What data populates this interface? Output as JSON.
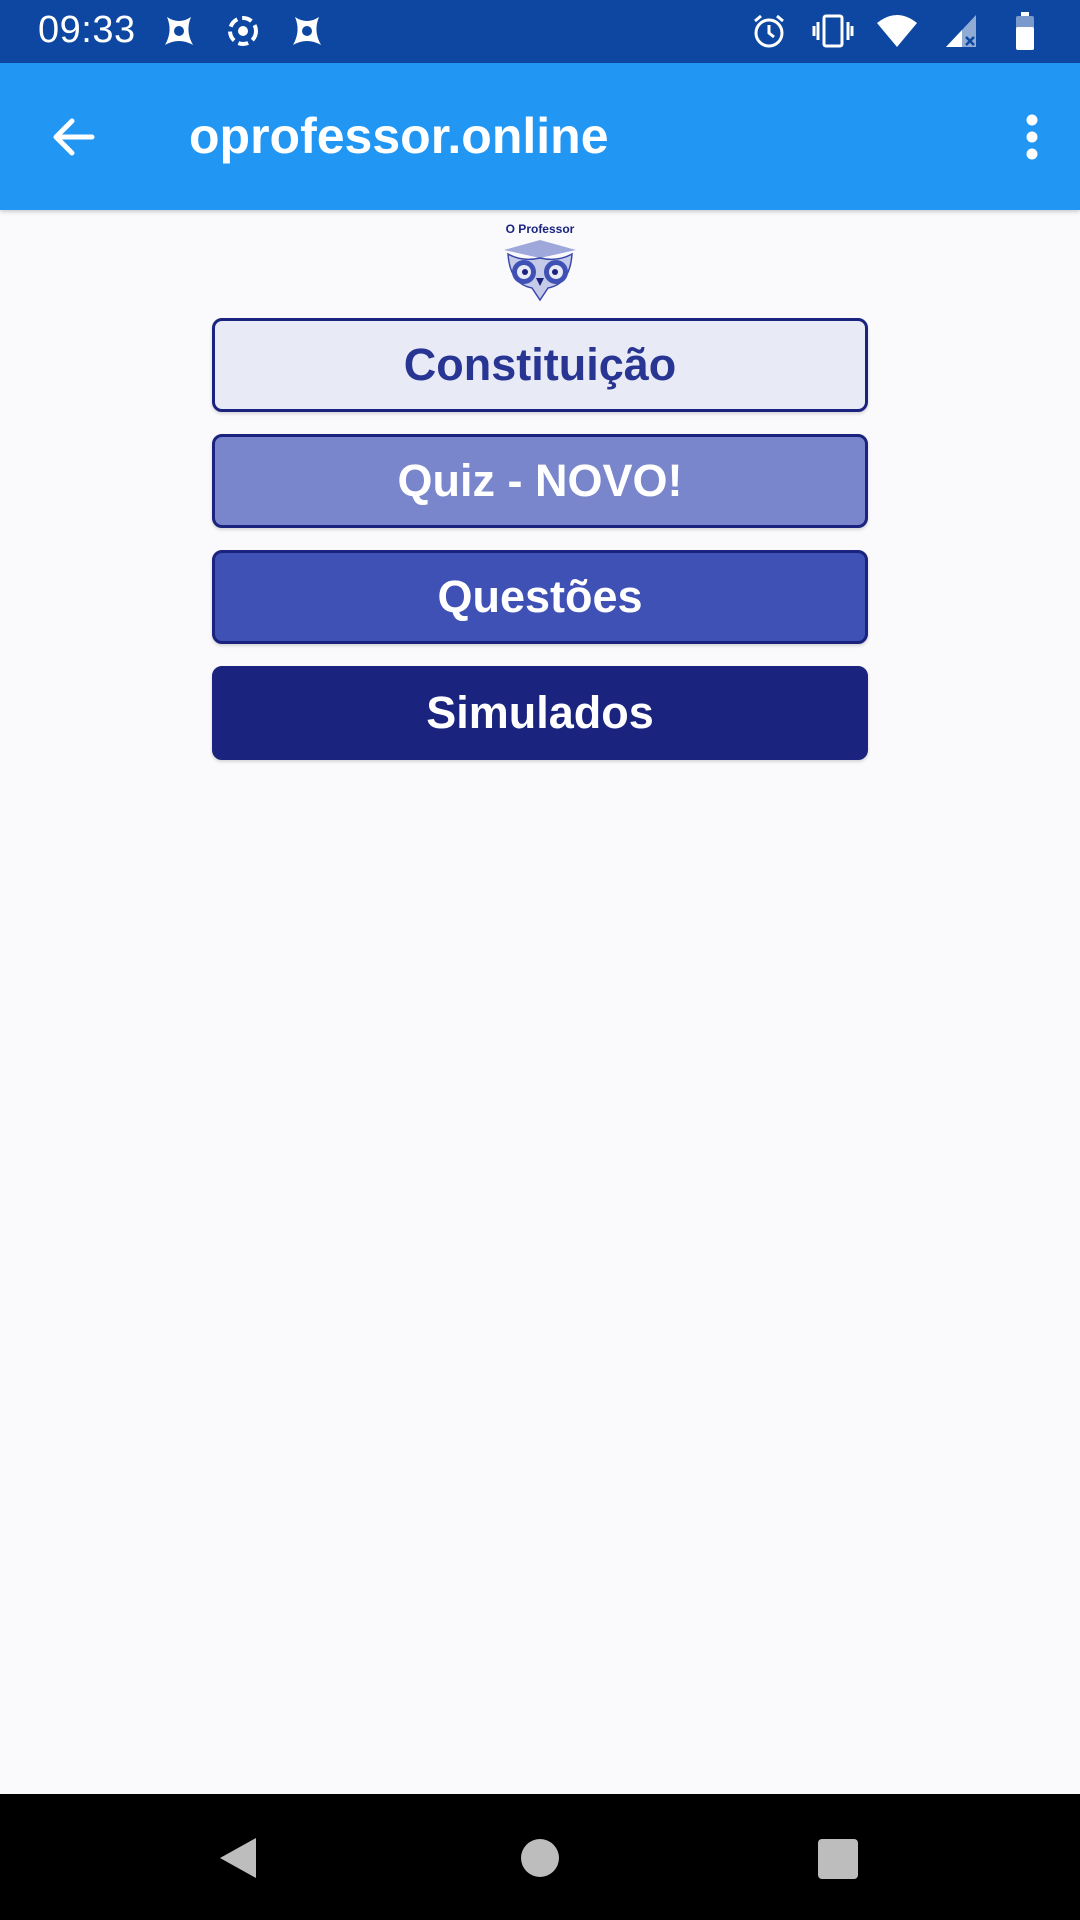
{
  "status_bar": {
    "time": "09:33",
    "left_icons": [
      "app-notification-icon",
      "sync-notification-icon",
      "app-notification-icon"
    ],
    "right_icons": [
      "alarm-icon",
      "vibrate-icon",
      "wifi-icon",
      "signal-icon",
      "battery-icon"
    ]
  },
  "app_bar": {
    "title": "oprofessor.online",
    "back_icon": "arrow-left-icon",
    "menu_icon": "more-vert-icon"
  },
  "logo": {
    "text": "O Professor"
  },
  "menu": {
    "items": [
      {
        "label": "Constituição",
        "bg": "#e8eaf6",
        "fg": "#283593"
      },
      {
        "label": "Quiz - NOVO!",
        "bg": "#7986cb",
        "fg": "#ffffff"
      },
      {
        "label": "Questões",
        "bg": "#3f51b5",
        "fg": "#ffffff"
      },
      {
        "label": "Simulados",
        "bg": "#1a237e",
        "fg": "#ffffff"
      }
    ]
  },
  "colors": {
    "status_bar": "#0d47a1",
    "app_bar": "#2196f3",
    "background": "#fafafc",
    "nav_bar": "#000000"
  }
}
